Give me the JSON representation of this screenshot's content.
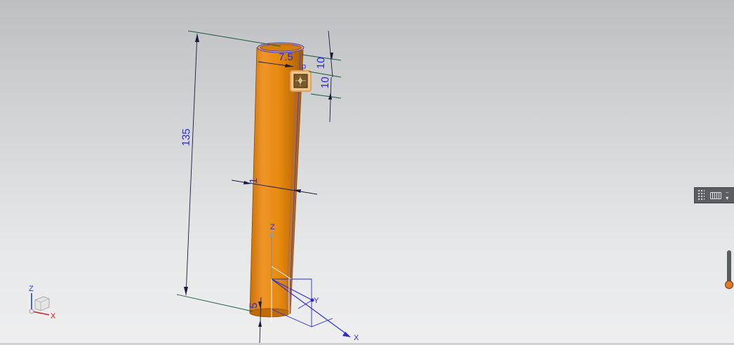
{
  "viewport": {
    "background_top": "#bdbfc2",
    "background_bottom": "#efeff0"
  },
  "model": {
    "part_color": "#e88a0a",
    "part_shadow": "#b86a06",
    "part_highlight": "#f4a23a",
    "dimension_color": "#2b2bd6",
    "extension_line_color": "#1a5a3a"
  },
  "dimensions": {
    "height": "135",
    "offset": "7.5",
    "top_gap": "10",
    "box_size": "10",
    "wall": "1",
    "bottom": "5"
  },
  "work_csys": {
    "x_label": "X",
    "y_label": "Y",
    "z_label": "Z"
  },
  "view_triad": {
    "x_label": "X",
    "z_label": "Z",
    "x_color": "#d02020",
    "z_color": "#2040d0"
  },
  "toolbar": {
    "icons": [
      "grip-icon",
      "keyboard-icon",
      "minimize-icon",
      "dropdown-icon"
    ],
    "minimize_glyph": "–",
    "dropdown_glyph": "▾"
  },
  "zoom_slider": {
    "level": 0.85,
    "knob_color": "#e07a2a"
  }
}
